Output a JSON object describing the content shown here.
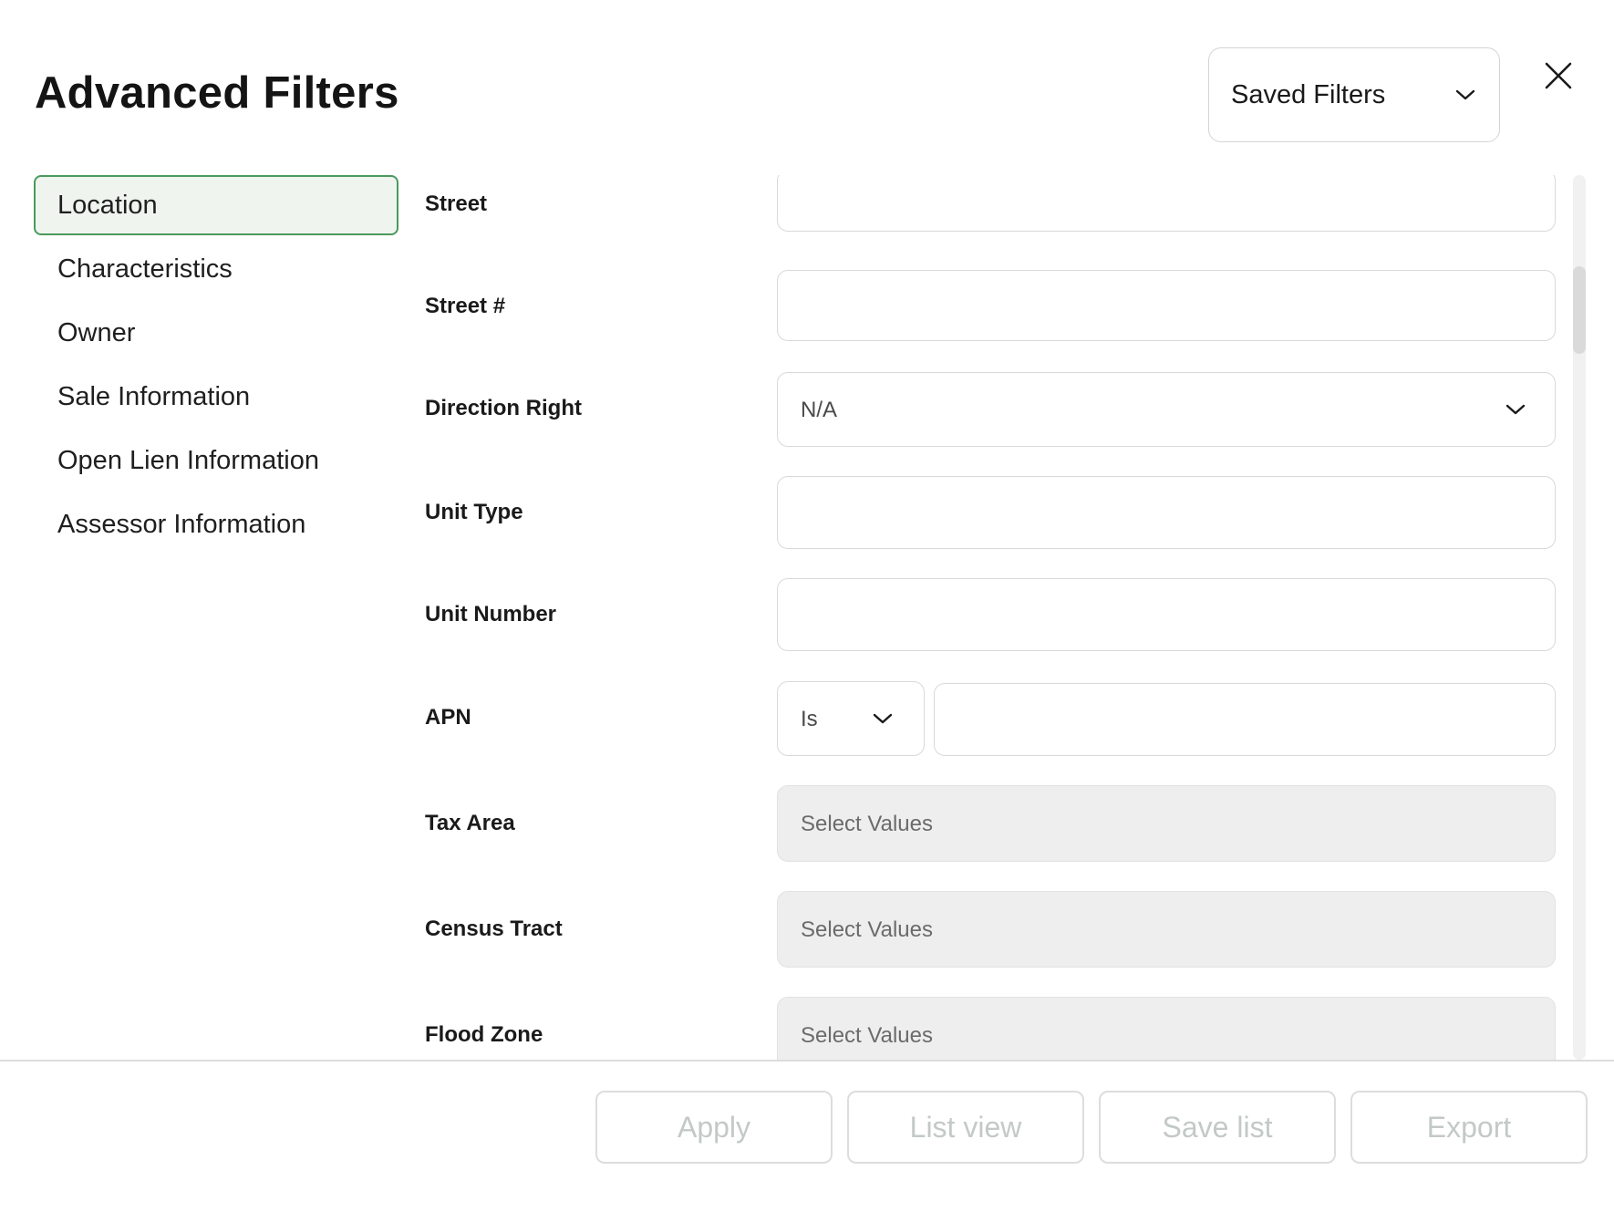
{
  "header": {
    "title": "Advanced Filters",
    "saved_filters_label": "Saved Filters"
  },
  "sidebar": {
    "items": [
      {
        "label": "Location",
        "active": true
      },
      {
        "label": "Characteristics",
        "active": false
      },
      {
        "label": "Owner",
        "active": false
      },
      {
        "label": "Sale Information",
        "active": false
      },
      {
        "label": "Open Lien Information",
        "active": false
      },
      {
        "label": "Assessor Information",
        "active": false
      }
    ]
  },
  "form": {
    "street": {
      "label": "Street",
      "value": ""
    },
    "street_number": {
      "label": "Street #",
      "value": ""
    },
    "direction_right": {
      "label": "Direction Right",
      "selected": "N/A"
    },
    "unit_type": {
      "label": "Unit Type",
      "value": ""
    },
    "unit_number": {
      "label": "Unit Number",
      "value": ""
    },
    "apn": {
      "label": "APN",
      "operator": "Is",
      "value": ""
    },
    "tax_area": {
      "label": "Tax Area",
      "placeholder": "Select Values"
    },
    "census_tract": {
      "label": "Census Tract",
      "placeholder": "Select Values"
    },
    "flood_zone": {
      "label": "Flood Zone",
      "placeholder": "Select Values"
    }
  },
  "footer": {
    "apply": "Apply",
    "list_view": "List view",
    "save_list": "Save list",
    "export": "Export"
  },
  "colors": {
    "active_border": "#4a9a5c",
    "active_bg": "#eff4ef",
    "disabled_field_bg": "#eeeeee",
    "disabled_button_text": "#c3c9c6"
  }
}
